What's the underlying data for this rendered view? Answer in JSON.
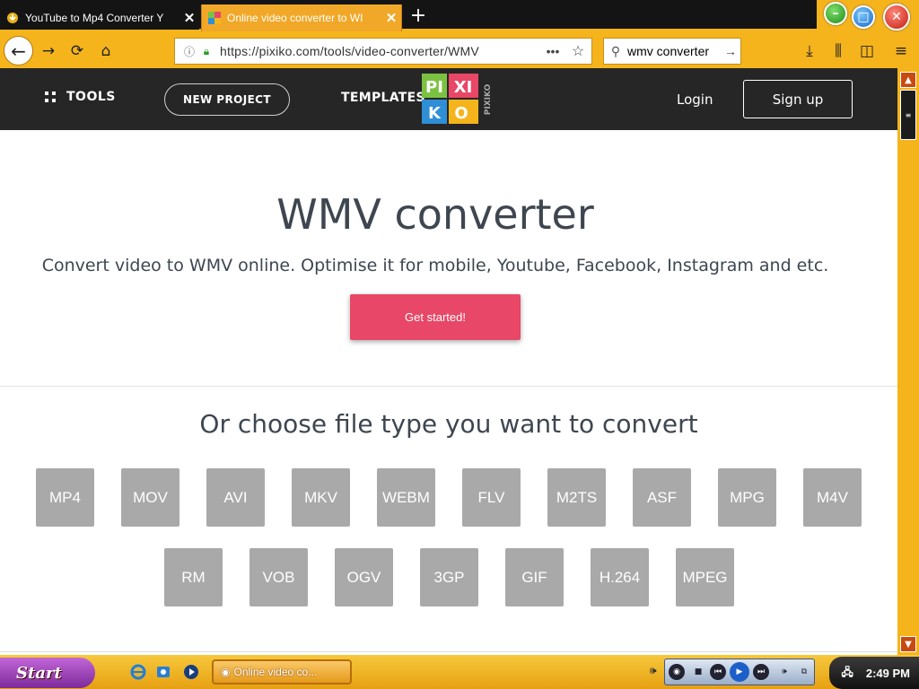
{
  "browser": {
    "tabs": [
      {
        "title": "YouTube to Mp4 Converter Y",
        "active": false
      },
      {
        "title": "Online video converter to WI",
        "active": true
      }
    ],
    "url": "https://pixiko.com/tools/video-converter/WMV",
    "search_value": "wmv converter"
  },
  "site": {
    "nav": {
      "tools": "TOOLS",
      "new_project": "NEW PROJECT",
      "templates": "TEMPLATES",
      "login": "Login",
      "signup": "Sign up"
    },
    "logo": {
      "l1": "PI",
      "l2": "XI",
      "l3": "K",
      "l4": "O",
      "side": "PIXIKO"
    },
    "hero": {
      "title": "WMV converter",
      "subtitle": "Convert video to WMV online. Optimise it for mobile, Youtube, Facebook, Instagram and etc.",
      "cta": "Get started!"
    },
    "choose_title": "Or choose file type you want to convert",
    "file_types_row1": [
      "MP4",
      "MOV",
      "AVI",
      "MKV",
      "WEBM",
      "FLV",
      "M2TS",
      "ASF",
      "MPG",
      "M4V"
    ],
    "file_types_row2": [
      "RM",
      "VOB",
      "OGV",
      "3GP",
      "GIF",
      "H.264",
      "MPEG"
    ]
  },
  "taskbar": {
    "start": "Start",
    "task_item": "Online video co...",
    "clock": "2:49 PM"
  },
  "colors": {
    "accent_orange": "#f5b41c",
    "header_dark": "#262626",
    "cta_pink": "#e84767",
    "tile_gray": "#a9a9a9",
    "text_slate": "#3e4650"
  }
}
